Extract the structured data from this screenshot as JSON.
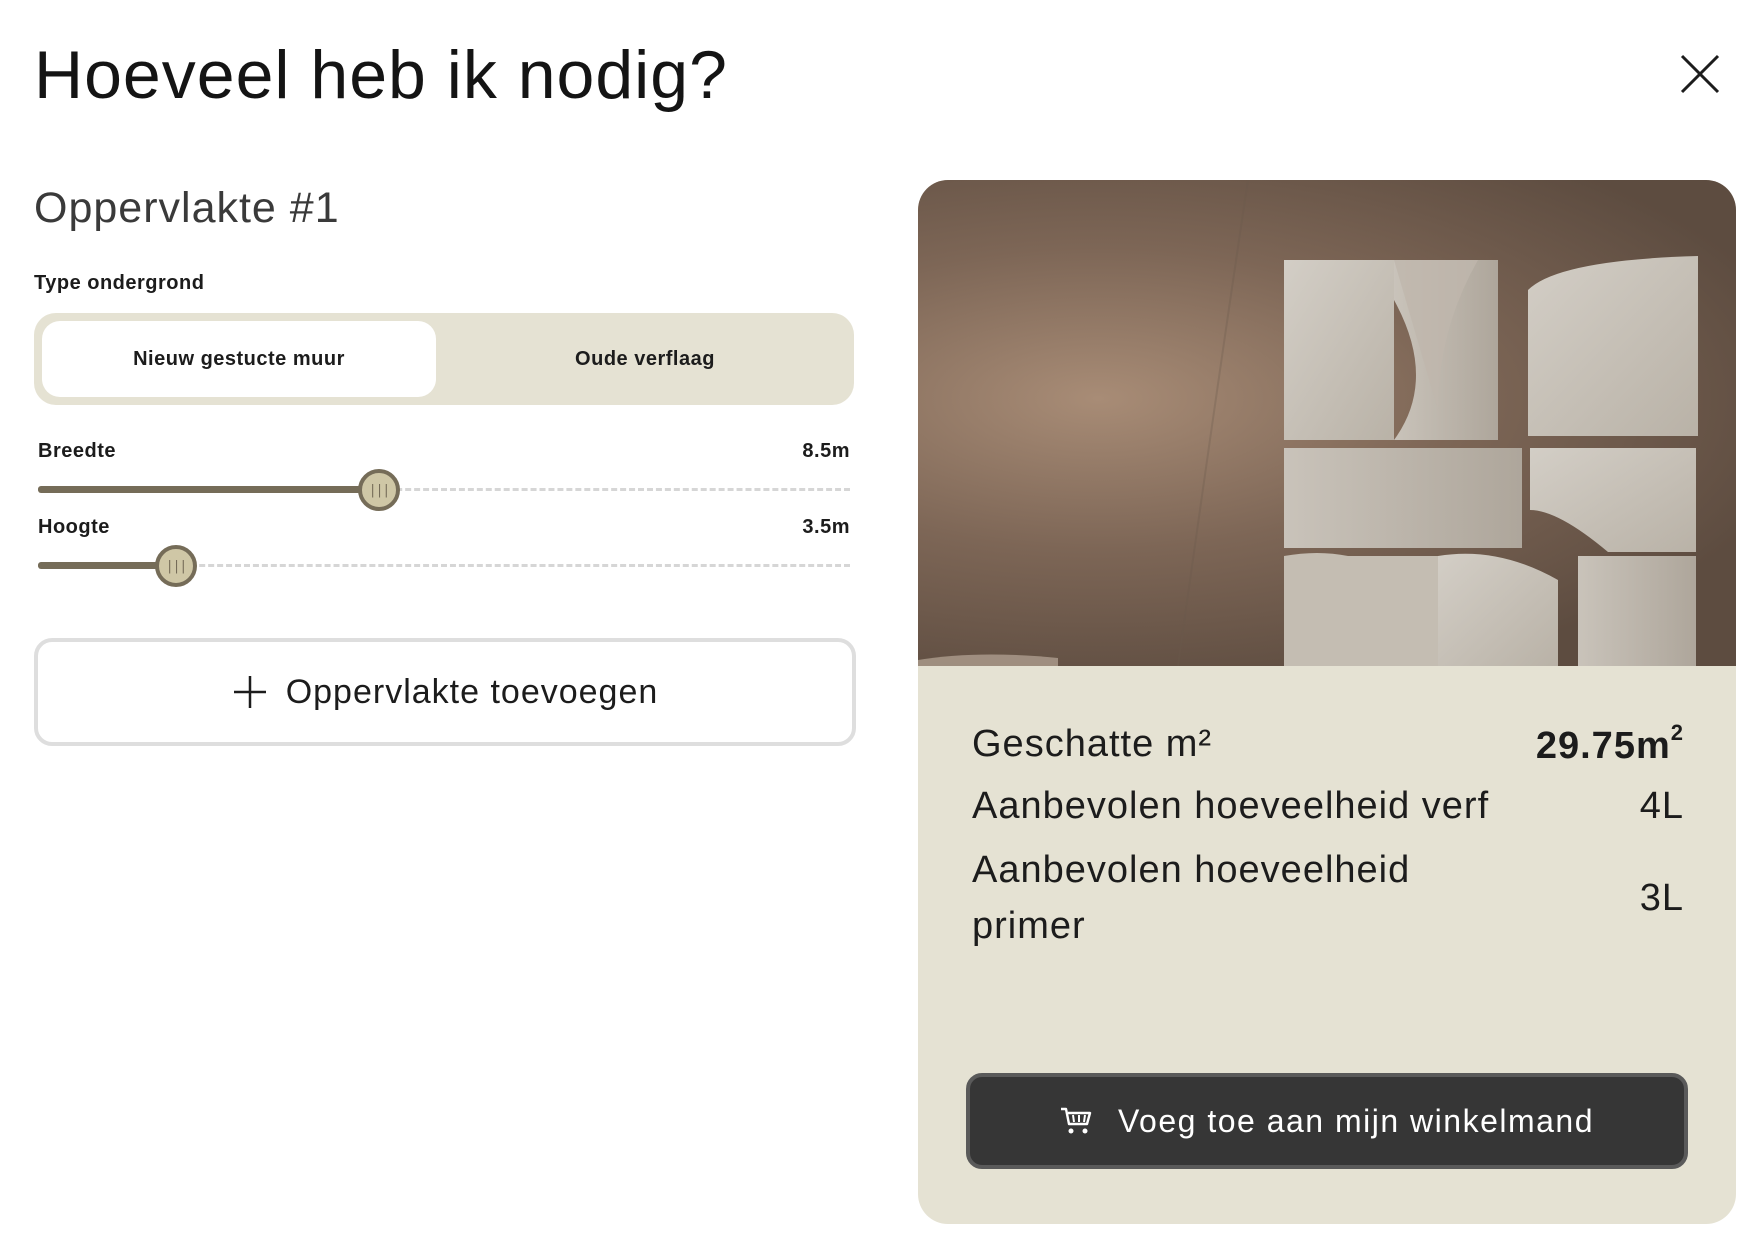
{
  "dialog": {
    "title": "Hoeveel heb ik nodig?",
    "close_icon": "close-icon"
  },
  "surface": {
    "title": "Oppervlakte #1",
    "substrate_label": "Type ondergrond",
    "substrate_options": [
      "Nieuw gestucte muur",
      "Oude verflaag"
    ],
    "substrate_selected": "Nieuw gestucte muur",
    "width": {
      "label": "Breedte",
      "value_text": "8.5m",
      "fill_fraction": 0.42
    },
    "height": {
      "label": "Hoogte",
      "value_text": "3.5m",
      "fill_fraction": 0.17
    },
    "slider_thumb_glyph": "|||"
  },
  "add_surface": {
    "label": "Oppervlakte toevoegen",
    "icon": "plus-icon"
  },
  "summary": {
    "estimated_label": "Geschatte m²",
    "estimated_value": "29.75m",
    "estimated_sup": "2",
    "paint_label": "Aanbevolen hoeveelheid verf",
    "paint_value": "4L",
    "primer_label": "Aanbevolen hoeveelheid primer",
    "primer_value": "3L"
  },
  "cart_button": {
    "label": "Voeg toe aan mijn winkelmand",
    "icon": "cart-icon"
  },
  "colors": {
    "accent": "#756c58",
    "panel_bg": "#e5e2d3",
    "button_dark": "#363636"
  }
}
